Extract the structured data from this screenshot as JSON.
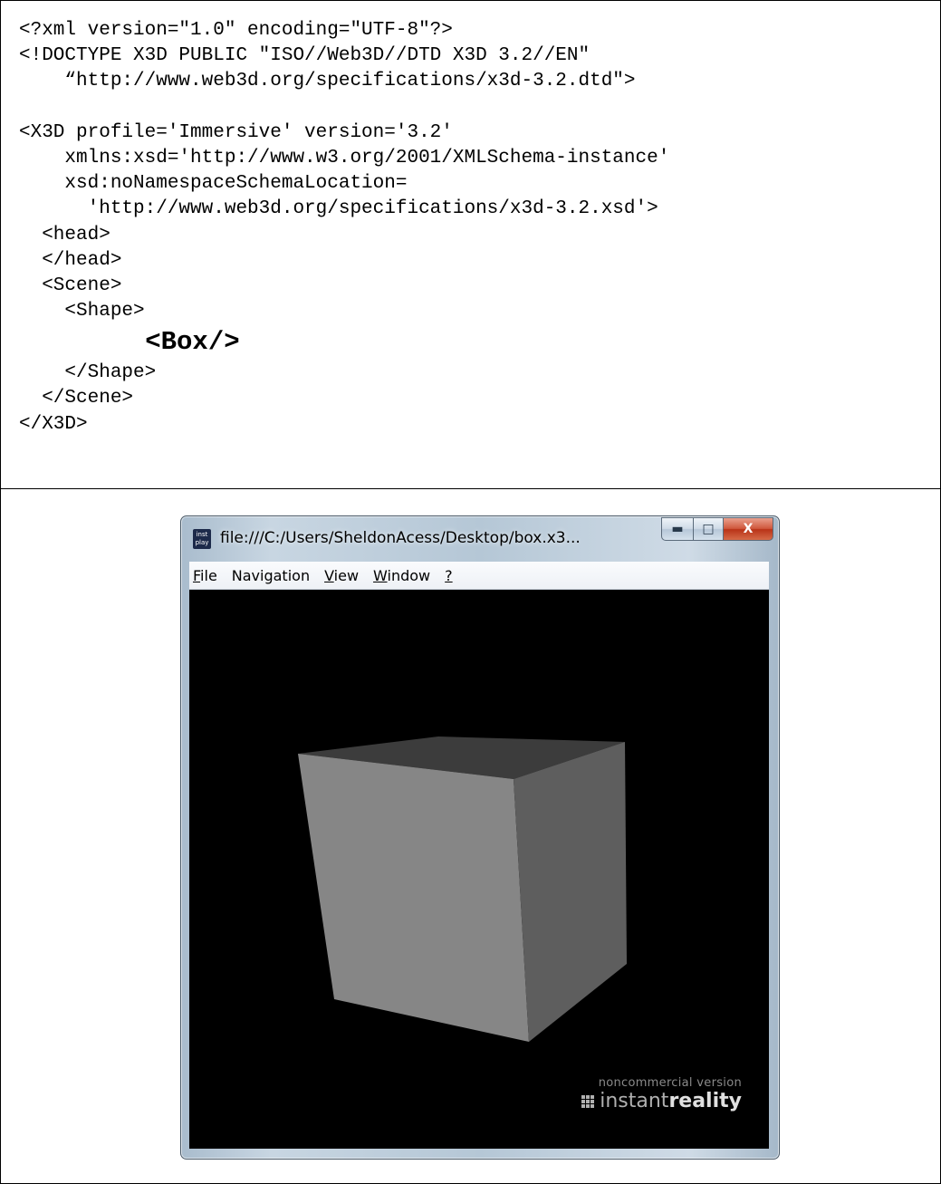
{
  "code": {
    "lines": [
      "<?xml version=\"1.0\" encoding=\"UTF-8\"?>",
      "<!DOCTYPE X3D PUBLIC \"ISO//Web3D//DTD X3D 3.2//EN\"",
      "    “http://www.web3d.org/specifications/x3d-3.2.dtd\">",
      "",
      "<X3D profile='Immersive' version='3.2'",
      "    xmlns:xsd='http://www.w3.org/2001/XMLSchema-instance'",
      "    xsd:noNamespaceSchemaLocation=",
      "      'http://www.web3d.org/specifications/x3d-3.2.xsd'>",
      "  <head>",
      "  </head>",
      "  <Scene>",
      "    <Shape>",
      "        <Box/>",
      "    </Shape>",
      "  </Scene>",
      "</X3D>"
    ]
  },
  "window": {
    "title": "file:///C:/Users/SheldonAcess/Desktop/box.x3...",
    "icon_text": "inst play",
    "caption_buttons": {
      "minimize": "minimize-icon",
      "maximize": "maximize-icon",
      "close": "close-icon",
      "close_glyph": "X"
    },
    "menu": [
      {
        "accel": "F",
        "rest": "ile"
      },
      {
        "accel": "",
        "rest": "Navigation"
      },
      {
        "accel": "V",
        "rest": "iew"
      },
      {
        "accel": "W",
        "rest": "indow"
      },
      {
        "accel": "?",
        "rest": ""
      }
    ]
  },
  "viewport": {
    "background": "#000000",
    "cube_colors": {
      "front": "#868686",
      "right": "#5e5e5e",
      "top": "#3c3c3c"
    },
    "watermark": {
      "line1": "noncommercial version",
      "brand_regular": "instant",
      "brand_bold": "reality"
    }
  }
}
